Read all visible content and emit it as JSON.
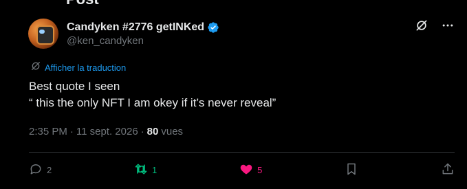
{
  "header_cut": "Post",
  "author": {
    "display_name": "Candyken #2776 getINKed",
    "handle": "@ken_candyken"
  },
  "translate_label": "Afficher la traduction",
  "post": {
    "line1": "Best quote I seen",
    "line2": "“ this the only NFT I am okey if it’s never reveal”"
  },
  "meta": {
    "time": "2:35 PM",
    "separator1": "·",
    "date": "11 sept. 2026",
    "separator2": "·",
    "views_count": "80",
    "views_label": "vues"
  },
  "actions": {
    "reply_count": "2",
    "retweet_count": "1",
    "like_count": "5"
  },
  "colors": {
    "accent_blue": "#1d9bf0",
    "retweet_green": "#00ba7c",
    "like_pink": "#f91880",
    "muted": "#71767b"
  }
}
